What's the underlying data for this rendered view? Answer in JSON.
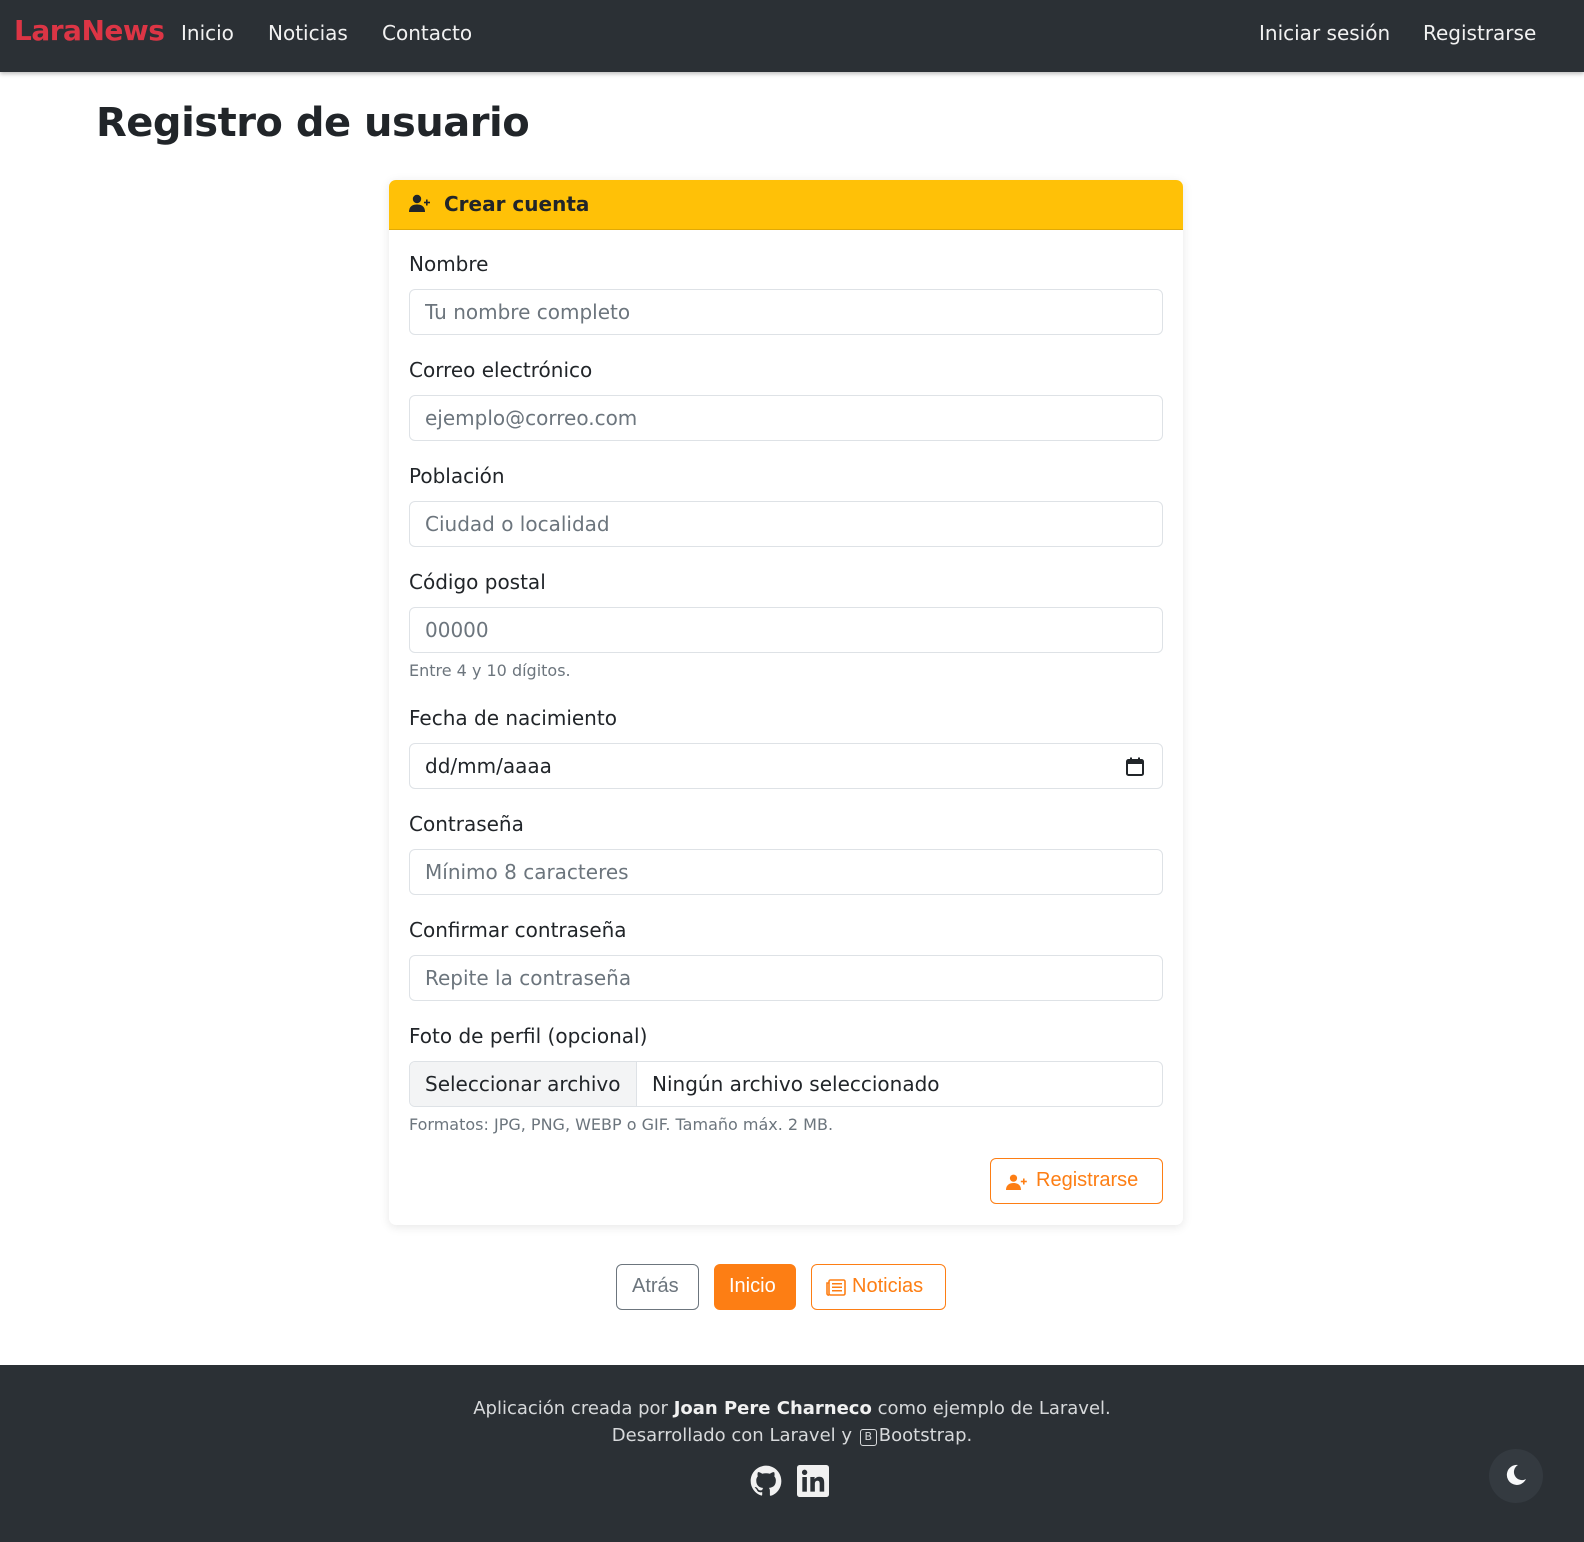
{
  "navbar": {
    "brand": "LaraNews",
    "links": [
      "Inicio",
      "Noticias",
      "Contacto"
    ],
    "right_links": [
      "Iniciar sesión",
      "Registrarse"
    ]
  },
  "page": {
    "title": "Registro de usuario"
  },
  "card": {
    "header_icon": "user-plus-icon",
    "header_title": "Crear cuenta",
    "fields": {
      "name": {
        "label": "Nombre",
        "placeholder": "Tu nombre completo"
      },
      "email": {
        "label": "Correo electrónico",
        "placeholder": "ejemplo@correo.com"
      },
      "city": {
        "label": "Población",
        "placeholder": "Ciudad o localidad"
      },
      "postal": {
        "label": "Código postal",
        "placeholder": "00000",
        "help": "Entre 4 y 10 dígitos."
      },
      "birth": {
        "label": "Fecha de nacimiento",
        "value": "dd/mm/aaaa",
        "icon": "calendar-icon"
      },
      "password": {
        "label": "Contraseña",
        "placeholder": "Mínimo 8 caracteres"
      },
      "password_confirm": {
        "label": "Confirmar contraseña",
        "placeholder": "Repite la contraseña"
      },
      "photo": {
        "label": "Foto de perfil (opcional)",
        "button": "Seleccionar archivo",
        "status": "Ningún archivo seleccionado",
        "help": "Formatos: JPG, PNG, WEBP o GIF. Tamaño máx. 2 MB."
      }
    },
    "submit": {
      "label": "Registrarse",
      "icon": "user-plus-icon"
    }
  },
  "bottom_buttons": {
    "back": "Atrás",
    "home": "Inicio",
    "news": "Noticias",
    "news_icon": "newspaper-icon"
  },
  "footer": {
    "line1_prefix": "Aplicación creada por",
    "author": "Joan Pere Charneco",
    "line1_suffix": "como ejemplo de Laravel.",
    "line2_prefix": "Desarrollado con Laravel y",
    "line2_badge": "B",
    "line2_suffix": "Bootstrap.",
    "social_icons": [
      "github-icon",
      "linkedin-icon"
    ]
  },
  "theme_toggle_icon": "moon-icon",
  "colors": {
    "navbar": "#2b3035",
    "brand": "#dc3545",
    "card_header": "#ffc107",
    "accent": "#fd7e14",
    "secondary": "#6c757d"
  }
}
